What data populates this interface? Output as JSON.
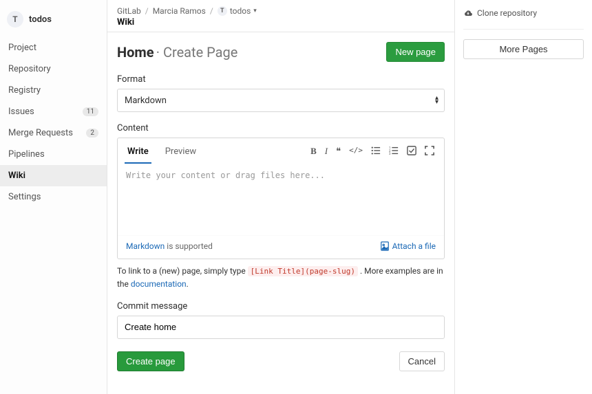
{
  "project": {
    "initial": "T",
    "name": "todos"
  },
  "sidebar": {
    "items": [
      {
        "label": "Project",
        "badge": null,
        "active": false
      },
      {
        "label": "Repository",
        "badge": null,
        "active": false
      },
      {
        "label": "Registry",
        "badge": null,
        "active": false
      },
      {
        "label": "Issues",
        "badge": "11",
        "active": false
      },
      {
        "label": "Merge Requests",
        "badge": "2",
        "active": false
      },
      {
        "label": "Pipelines",
        "badge": null,
        "active": false
      },
      {
        "label": "Wiki",
        "badge": null,
        "active": true
      },
      {
        "label": "Settings",
        "badge": null,
        "active": false
      }
    ]
  },
  "breadcrumbs": {
    "root": "GitLab",
    "user": "Marcia Ramos",
    "project_initial": "T",
    "project": "todos",
    "section": "Wiki"
  },
  "page": {
    "title": "Home",
    "subtitle": "· Create Page",
    "new_page_btn": "New page"
  },
  "format": {
    "label": "Format",
    "value": "Markdown"
  },
  "content": {
    "label": "Content",
    "tab_write": "Write",
    "tab_preview": "Preview",
    "placeholder": "Write your content or drag files here...",
    "footer_link": "Markdown",
    "footer_text": " is supported",
    "attach": "Attach a file"
  },
  "help": {
    "prefix": "To link to a (new) page, simply type ",
    "code": "[Link Title](page-slug)",
    "suffix": " . More examples are in the ",
    "doc_link": "documentation",
    "tail": "."
  },
  "commit": {
    "label": "Commit message",
    "value": "Create home"
  },
  "actions": {
    "submit": "Create page",
    "cancel": "Cancel"
  },
  "rightbar": {
    "clone": "Clone repository",
    "more_pages": "More Pages"
  }
}
